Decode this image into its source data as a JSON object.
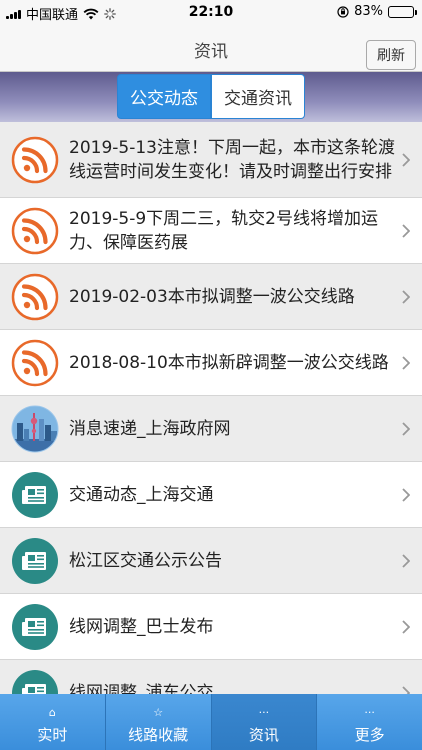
{
  "status_bar": {
    "carrier": "中国联通",
    "time": "22:10",
    "battery": "83%",
    "battery_level": 0.83
  },
  "nav": {
    "title": "资讯",
    "refresh_label": "刷新"
  },
  "segments": [
    {
      "label": "公交动态",
      "active": true
    },
    {
      "label": "交通资讯",
      "active": false
    }
  ],
  "list": [
    {
      "text": "2019-5-13注意！下周一起，本市这条轮渡线运营时间发生变化！请及时调整出行安排",
      "icon": "rss-icon"
    },
    {
      "text": "2019-5-9下周二三，轨交2号线将增加运力、保障医药展",
      "icon": "rss-icon"
    },
    {
      "text": "2019-02-03本市拟调整一波公交线路",
      "icon": "rss-icon"
    },
    {
      "text": "2018-08-10本市拟新辟调整一波公交线路",
      "icon": "rss-icon"
    },
    {
      "text": "消息速递_上海政府网",
      "icon": "shanghai-skyline-icon"
    },
    {
      "text": "交通动态_上海交通",
      "icon": "newspaper-icon"
    },
    {
      "text": "松江区交通公示公告",
      "icon": "newspaper-icon"
    },
    {
      "text": "线网调整_巴士发布",
      "icon": "newspaper-icon"
    },
    {
      "text": "线网调整_浦东公交",
      "icon": "newspaper-icon"
    }
  ],
  "tabs": [
    {
      "label": "实时",
      "icon": "home-icon",
      "glyph": "⌂",
      "active": false
    },
    {
      "label": "线路收藏",
      "icon": "star-icon",
      "glyph": "☆",
      "active": false
    },
    {
      "label": "资讯",
      "icon": "ellipsis-icon",
      "glyph": "···",
      "active": true
    },
    {
      "label": "更多",
      "icon": "ellipsis-icon",
      "glyph": "···",
      "active": false
    }
  ],
  "colors": {
    "accent": "#2f8ee0",
    "rss_orange": "#e8692a",
    "news_teal": "#2a8a86",
    "tab_bar": "#3c93e0"
  }
}
